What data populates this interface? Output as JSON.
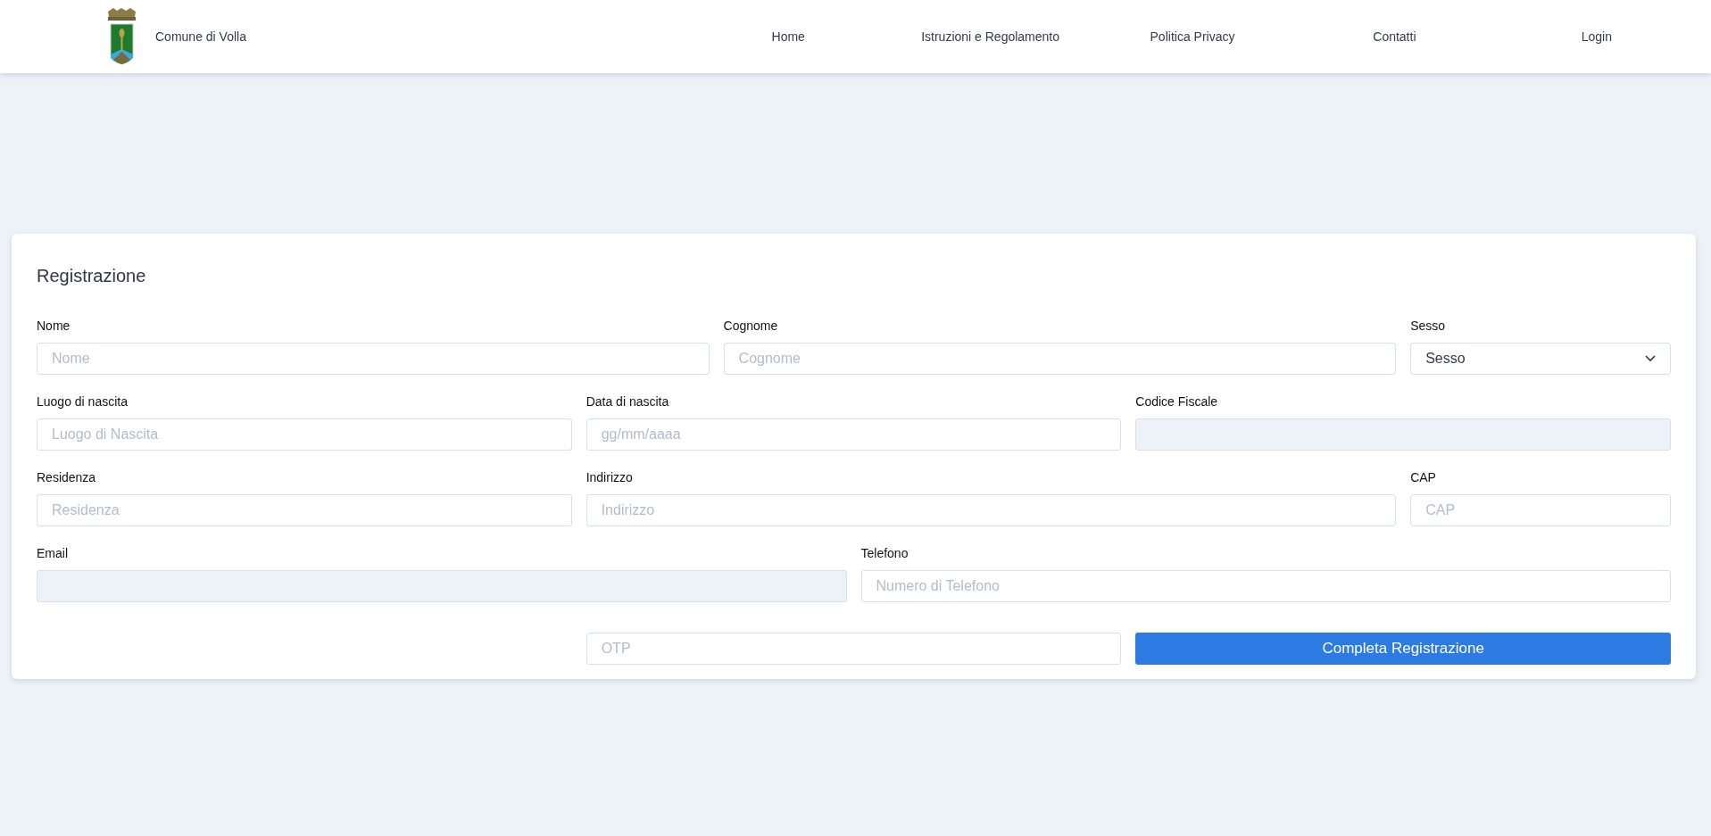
{
  "header": {
    "brand": "Comune di Volla",
    "nav": [
      {
        "label": "Home"
      },
      {
        "label": "Istruzioni e Regolamento"
      },
      {
        "label": "Politica Privacy"
      },
      {
        "label": "Contatti"
      },
      {
        "label": "Login"
      }
    ]
  },
  "form": {
    "title": "Registrazione",
    "rows": [
      {
        "fields": [
          {
            "kind": "input",
            "label": "Nome",
            "placeholder": "Nome",
            "disabled": false
          },
          {
            "kind": "input",
            "label": "Cognome",
            "placeholder": "Cognome",
            "disabled": false
          },
          {
            "kind": "select",
            "label": "Sesso",
            "value": "Sesso",
            "disabled": false
          }
        ]
      },
      {
        "fields": [
          {
            "kind": "input",
            "label": "Luogo di nascita",
            "placeholder": "Luogo di Nascita",
            "disabled": false
          },
          {
            "kind": "input",
            "label": "Data di nascita",
            "placeholder": "gg/mm/aaaa",
            "disabled": false
          },
          {
            "kind": "input",
            "label": "Codice Fiscale",
            "disabled": true
          }
        ]
      },
      {
        "fields": [
          {
            "kind": "input",
            "label": "Residenza",
            "placeholder": "Residenza",
            "disabled": false
          },
          {
            "kind": "input",
            "label": "Indirizzo",
            "placeholder": "Indirizzo",
            "disabled": false
          },
          {
            "kind": "input",
            "label": "CAP",
            "placeholder": "CAP",
            "disabled": false
          }
        ]
      },
      {
        "fields": [
          {
            "kind": "input",
            "label": "Email",
            "disabled": true
          },
          {
            "kind": "input",
            "label": "Telefono",
            "placeholder": "Numero di Telefono",
            "disabled": false
          }
        ]
      }
    ],
    "otp": {
      "placeholder": "OTP"
    },
    "submit": "Completa Registrazione"
  }
}
